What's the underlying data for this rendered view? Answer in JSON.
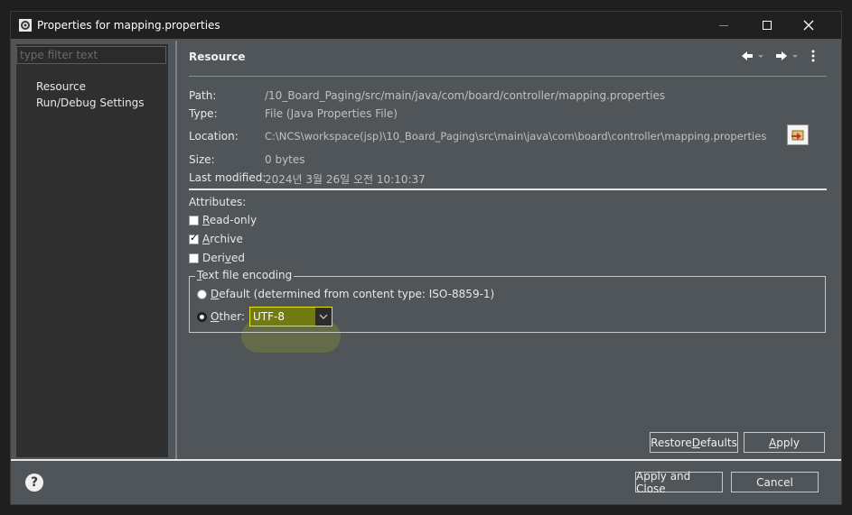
{
  "window": {
    "title": "Properties for mapping.properties"
  },
  "sidebar": {
    "filter_placeholder": "type filter text",
    "items": [
      {
        "label": "Resource"
      },
      {
        "label": "Run/Debug Settings"
      }
    ]
  },
  "page": {
    "title": "Resource",
    "path_label": "Path:",
    "path_value": "/10_Board_Paging/src/main/java/com/board/controller/mapping.properties",
    "type_label": "Type:",
    "type_value": "File  (Java Properties File)",
    "location_label": "Location:",
    "location_value": "C:\\NCS\\workspace(jsp)\\10_Board_Paging\\src\\main\\java\\com\\board\\controller\\mapping.properties",
    "size_label": "Size:",
    "size_value": "0  bytes",
    "modified_label": "Last modified:",
    "modified_value": "2024년 3월 26일 오전 10:10:37",
    "attributes_label": "Attributes:",
    "attributes": [
      {
        "label_prefix": "",
        "label_u": "R",
        "label_rest": "ead-only",
        "checked": false
      },
      {
        "label_prefix": "",
        "label_u": "A",
        "label_rest": "rchive",
        "checked": true
      },
      {
        "label_prefix": "Deri",
        "label_u": "v",
        "label_rest": "ed",
        "checked": false
      }
    ],
    "encoding": {
      "legend_u": "T",
      "legend_rest": "ext file encoding",
      "default_u": "D",
      "default_rest": "efault (determined from content type: ISO-8859-1)",
      "other_u": "O",
      "other_rest": "ther:",
      "selected": "Other",
      "other_value": "UTF-8"
    }
  },
  "buttons": {
    "restore_prefix": "Restore ",
    "restore_u": "D",
    "restore_rest": "efaults",
    "apply_u": "A",
    "apply_rest": "pply",
    "apply_close": "Apply and Close",
    "cancel": "Cancel"
  },
  "colors": {
    "highlight": "#e8e800",
    "window_bg": "#505559",
    "titlebar": "#202020"
  }
}
